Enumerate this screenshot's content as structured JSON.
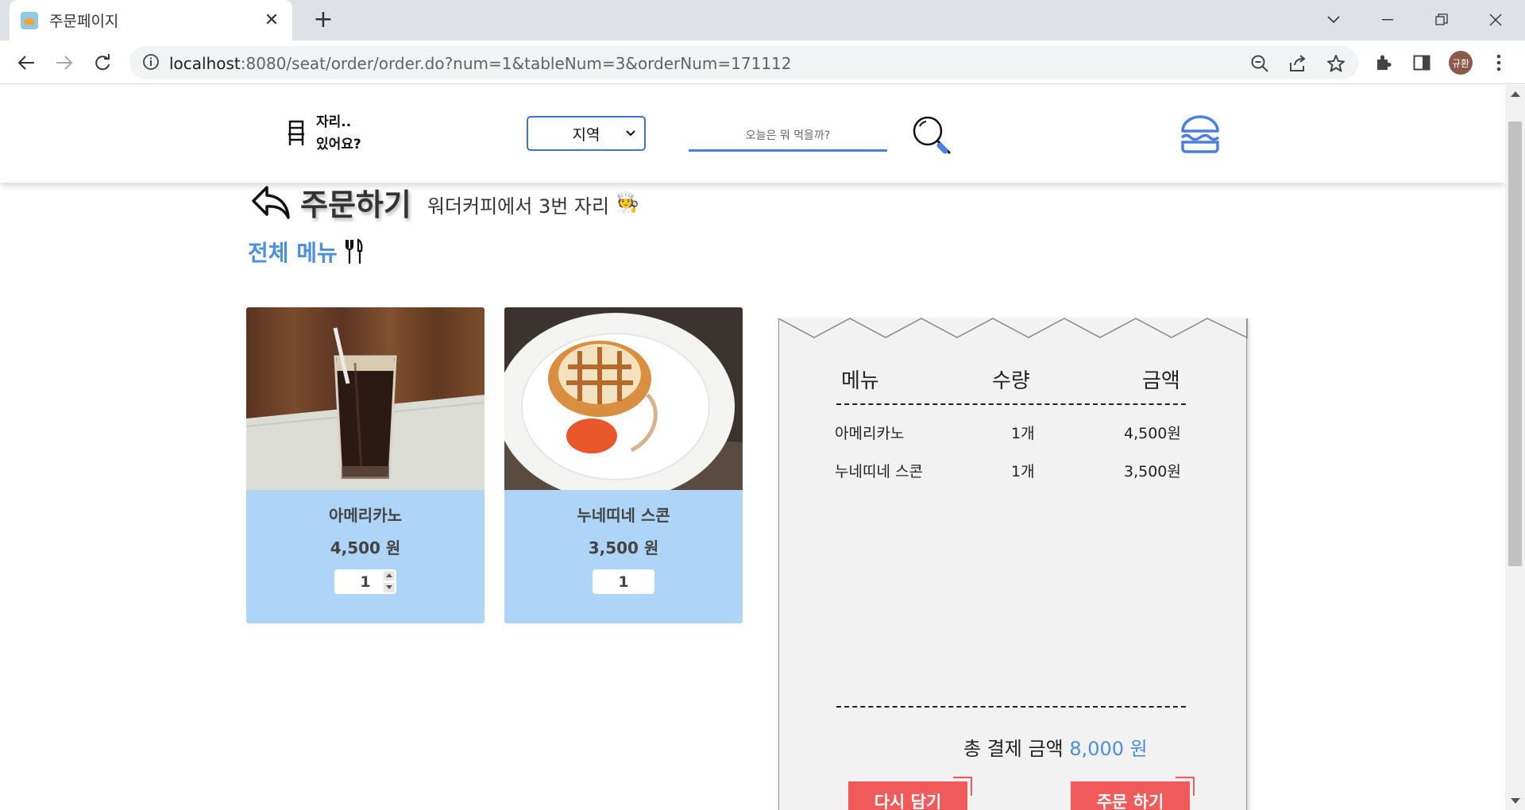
{
  "browser": {
    "tab_title": "주문페이지",
    "url_host": "localhost",
    "url_rest": ":8080/seat/order/order.do?num=1&tableNum=3&orderNum=171112",
    "profile_initials": "규환"
  },
  "header": {
    "logo_line1": "자리..",
    "logo_line2": "있어요?",
    "region_label": "지역",
    "search_placeholder": "오늘은 뭐 먹을까?"
  },
  "title": {
    "text": "주문하기",
    "subtitle": "워더커피에서 3번 자리",
    "chef_emoji": "🧑‍🍳"
  },
  "menu_heading": "전체 메뉴",
  "menu_cards": [
    {
      "name": "아메리카노",
      "price": "4,500 원",
      "qty": "1"
    },
    {
      "name": "누네띠네 스콘",
      "price": "3,500 원",
      "qty": "1"
    }
  ],
  "receipt": {
    "col_menu": "메뉴",
    "col_qty": "수량",
    "col_amount": "금액",
    "rows": [
      {
        "menu": "아메리카노",
        "qty": "1개",
        "amount": "4,500원"
      },
      {
        "menu": "누네띠네 스콘",
        "qty": "1개",
        "amount": "3,500원"
      }
    ],
    "total_label": "총 결제 금액",
    "total_amount": "8,000 원",
    "reset_button": "다시 담기",
    "order_button": "주문 하기"
  },
  "colors": {
    "accent_blue": "#4a8fe0",
    "card_bg": "#aed4f7",
    "button_red": "#f05a5a"
  }
}
